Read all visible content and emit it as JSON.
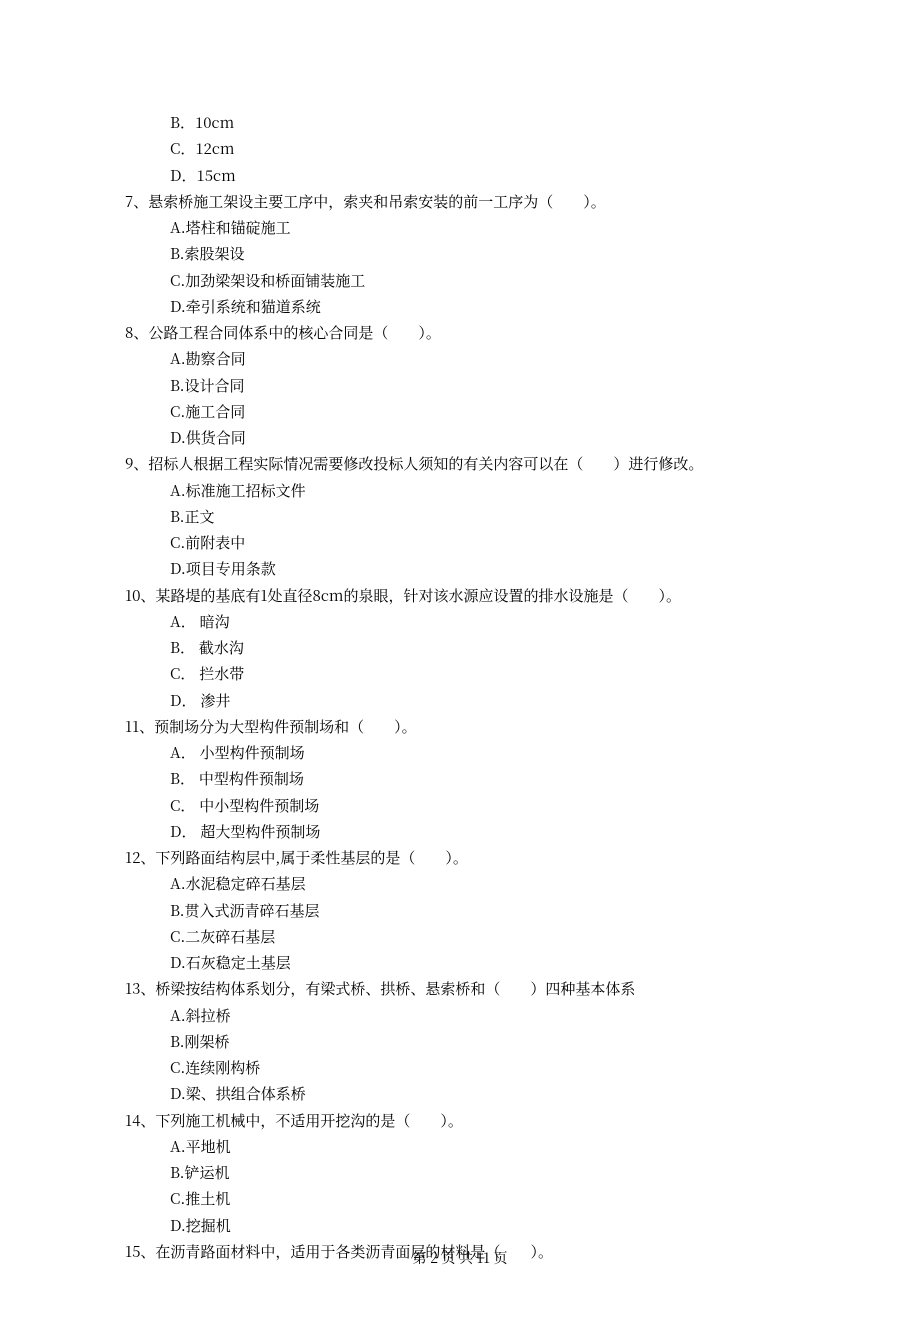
{
  "items": {
    "q6_optB": "B．10cm",
    "q6_optC": "C．12cm",
    "q6_optD": "D．15cm",
    "q7_stem": "7、悬索桥施工架设主要工序中，索夹和吊索安装的前一工序为（　　）。",
    "q7_optA": "A.塔柱和锚碇施工",
    "q7_optB": "B.索股架设",
    "q7_optC": "C.加劲梁架设和桥面铺装施工",
    "q7_optD": "D.牵引系统和猫道系统",
    "q8_stem": "8、公路工程合同体系中的核心合同是（　　）。",
    "q8_optA": "A.勘察合同",
    "q8_optB": "B.设计合同",
    "q8_optC": "C.施工合同",
    "q8_optD": "D.供货合同",
    "q9_stem": "9、招标人根据工程实际情况需要修改投标人须知的有关内容可以在（　　）进行修改。",
    "q9_optA": "A.标准施工招标文件",
    "q9_optB": "B.正文",
    "q9_optC": "C.前附表中",
    "q9_optD": "D.项目专用条款",
    "q10_stem": "10、某路堤的基底有1处直径8cm的泉眼，针对该水源应设置的排水设施是（　　）。",
    "q10_optA": "A． 暗沟",
    "q10_optB": "B． 截水沟",
    "q10_optC": "C． 拦水带",
    "q10_optD": "D． 渗井",
    "q11_stem": "11、预制场分为大型构件预制场和（　　）。",
    "q11_optA": "A． 小型构件预制场",
    "q11_optB": "B． 中型构件预制场",
    "q11_optC": "C． 中小型构件预制场",
    "q11_optD": "D． 超大型构件预制场",
    "q12_stem": "12、下列路面结构层中,属于柔性基层的是（　　）。",
    "q12_optA": "A.水泥稳定碎石基层",
    "q12_optB": "B.贯入式沥青碎石基层",
    "q12_optC": "C.二灰碎石基层",
    "q12_optD": "D.石灰稳定土基层",
    "q13_stem": "13、桥梁按结构体系划分，有梁式桥、拱桥、悬索桥和（　　）四种基本体系",
    "q13_optA": "A.斜拉桥",
    "q13_optB": "B.刚架桥",
    "q13_optC": "C.连续刚构桥",
    "q13_optD": "D.梁、拱组合体系桥",
    "q14_stem": "14、下列施工机械中，不适用开挖沟的是（　　）。",
    "q14_optA": "A.平地机",
    "q14_optB": "B.铲运机",
    "q14_optC": "C.推土机",
    "q14_optD": "D.挖掘机",
    "q15_stem": "15、在沥青路面材料中，适用于各类沥青面层的材料是（　　）。"
  },
  "footer": "第 2 页 共 11 页"
}
